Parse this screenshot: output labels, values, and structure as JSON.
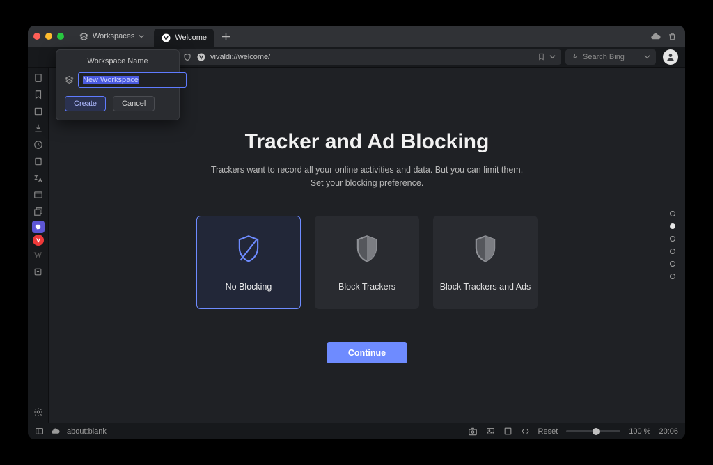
{
  "tabbar": {
    "workspaces_label": "Workspaces",
    "tab_title": "Welcome"
  },
  "addressbar": {
    "url": "vivaldi://welcome/",
    "search_placeholder": "Search Bing"
  },
  "popup": {
    "label": "Workspace Name",
    "input_value": "New Workspace",
    "create": "Create",
    "cancel": "Cancel"
  },
  "page": {
    "title": "Tracker and Ad Blocking",
    "subtitle": "Trackers want to record all your online activities and data. But you can limit them. Set your blocking preference.",
    "card_noblock": "No Blocking",
    "card_trackers": "Block Trackers",
    "card_ads": "Block Trackers and Ads",
    "continue": "Continue"
  },
  "status": {
    "url": "about:blank",
    "reset": "Reset",
    "zoom": "100 %",
    "clock": "20:06"
  },
  "steps": {
    "total": 6,
    "active_index": 1
  }
}
